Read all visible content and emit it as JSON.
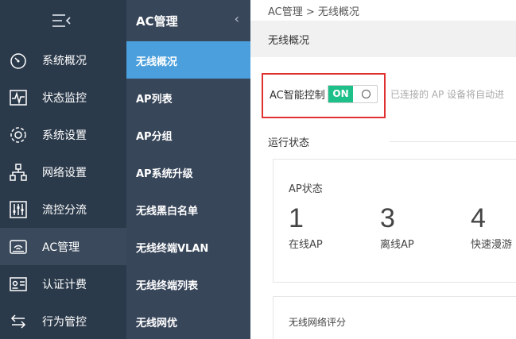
{
  "nav": {
    "items": [
      {
        "label": "系统概况",
        "icon": "speedometer-icon"
      },
      {
        "label": "状态监控",
        "icon": "pulse-icon"
      },
      {
        "label": "系统设置",
        "icon": "gear-icon"
      },
      {
        "label": "网络设置",
        "icon": "network-icon"
      },
      {
        "label": "流控分流",
        "icon": "sliders-icon"
      },
      {
        "label": "AC管理",
        "icon": "router-icon"
      },
      {
        "label": "认证计费",
        "icon": "id-card-icon"
      },
      {
        "label": "行为管控",
        "icon": "arrows-icon"
      }
    ]
  },
  "subnav": {
    "title": "AC管理",
    "items": [
      {
        "label": "无线概况"
      },
      {
        "label": "AP列表"
      },
      {
        "label": "AP分组"
      },
      {
        "label": "AP系统升级"
      },
      {
        "label": "无线黑白名单"
      },
      {
        "label": "无线终端VLAN"
      },
      {
        "label": "无线终端列表"
      },
      {
        "label": "无线网优"
      }
    ]
  },
  "main": {
    "breadcrumb": "AC管理 > 无线概况",
    "page_title": "无线概况",
    "ac_control": {
      "label": "AC智能控制",
      "state": "ON"
    },
    "hint": "已连接的 AP 设备将自动进",
    "section_title": "运行状态",
    "ap_card": {
      "title": "AP状态",
      "stats": [
        {
          "value": "1",
          "label": "在线AP"
        },
        {
          "value": "3",
          "label": "离线AP"
        },
        {
          "value": "4",
          "label": "快速漫游"
        }
      ]
    },
    "score_card": {
      "title": "无线网络评分"
    }
  },
  "colors": {
    "nav_bg": "#2b3a4b",
    "subnav_bg": "#38465a",
    "active_blue": "#4a9fdc",
    "switch_on": "#1ec08a",
    "highlight_red": "#e03131"
  }
}
